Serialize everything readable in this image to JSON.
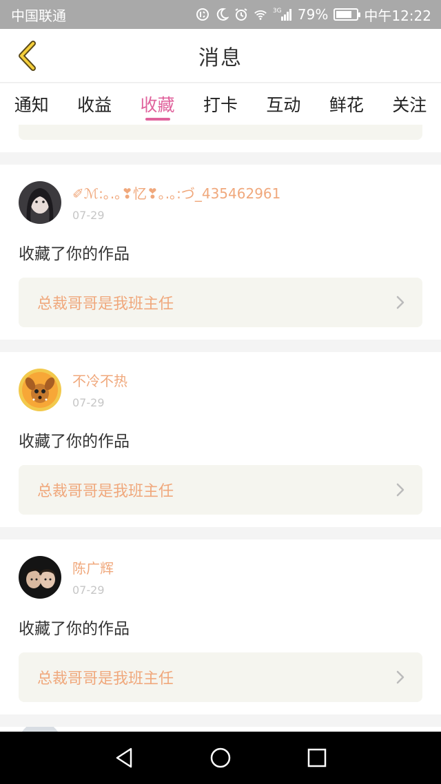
{
  "status_bar": {
    "carrier": "中国联通",
    "network": "3G",
    "battery": "79%",
    "battery_level": 0.79,
    "time": "中午12:22"
  },
  "header": {
    "title": "消息",
    "back_icon": "chevron-left-icon"
  },
  "tabs": [
    {
      "label": "通知",
      "active": false
    },
    {
      "label": "收益",
      "active": false
    },
    {
      "label": "收藏",
      "active": true
    },
    {
      "label": "打卡",
      "active": false
    },
    {
      "label": "互动",
      "active": false
    },
    {
      "label": "鲜花",
      "active": false
    },
    {
      "label": "关注",
      "active": false
    }
  ],
  "notifications": [
    {
      "username": "✐ℳ:｡.｡❣忆❣｡.｡:づ_435462961",
      "date": "07-29",
      "action": "收藏了你的作品",
      "work_title": "总裁哥哥是我班主任"
    },
    {
      "username": "不冷不热",
      "date": "07-29",
      "action": "收藏了你的作品",
      "work_title": "总裁哥哥是我班主任"
    },
    {
      "username": "陈广辉",
      "date": "07-29",
      "action": "收藏了你的作品",
      "work_title": "总裁哥哥是我班主任"
    }
  ],
  "colors": {
    "accent": "#e0629c",
    "username": "#f0a87c",
    "work_bg": "#f5f5ef"
  }
}
